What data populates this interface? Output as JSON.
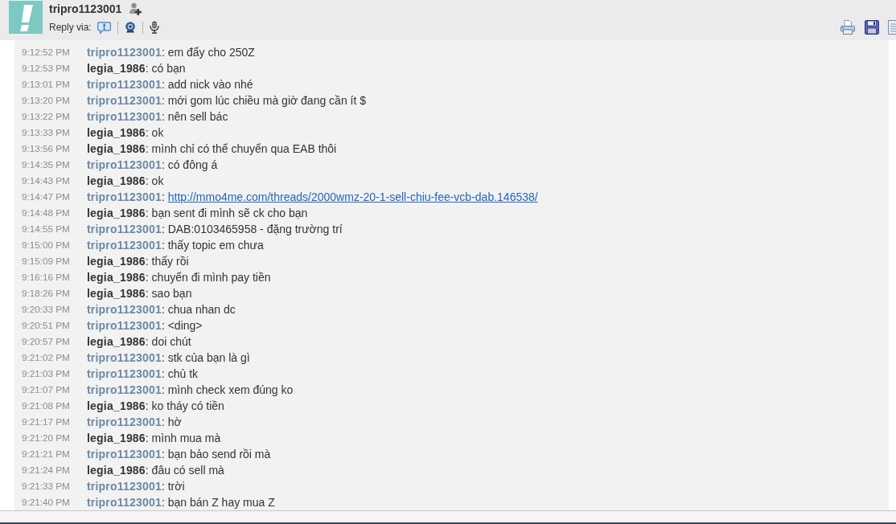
{
  "header": {
    "contact_name": "tripro1123001",
    "reply_via_label": "Reply via:"
  },
  "messages": [
    {
      "time": "9:12:52 PM",
      "sender": "tripro1123001",
      "kind": "contact",
      "text": ": em đẩy cho 250Z"
    },
    {
      "time": "9:12:53 PM",
      "sender": "legia_1986",
      "kind": "self",
      "text": ": có bạn"
    },
    {
      "time": "9:13:01 PM",
      "sender": "tripro1123001",
      "kind": "contact",
      "text": ": add nick vào nhé"
    },
    {
      "time": "9:13:20 PM",
      "sender": "tripro1123001",
      "kind": "contact",
      "text": ": mới gom lúc chiều mà giờ đang cần ít $"
    },
    {
      "time": "9:13:22 PM",
      "sender": "tripro1123001",
      "kind": "contact",
      "text": ": nên sell bác"
    },
    {
      "time": "9:13:33 PM",
      "sender": "legia_1986",
      "kind": "self",
      "text": ": ok"
    },
    {
      "time": "9:13:56 PM",
      "sender": "legia_1986",
      "kind": "self",
      "text": ": mình chỉ có thể chuyển qua EAB thôi"
    },
    {
      "time": "9:14:35 PM",
      "sender": "tripro1123001",
      "kind": "contact",
      "text": ": có đông á"
    },
    {
      "time": "9:14:43 PM",
      "sender": "legia_1986",
      "kind": "self",
      "text": ": ok"
    },
    {
      "time": "9:14:47 PM",
      "sender": "tripro1123001",
      "kind": "contact",
      "text": ":",
      "link": "http://mmo4me.com/threads/2000wmz-20-1-sell-chiu-fee-vcb-dab.146538/"
    },
    {
      "time": "9:14:48 PM",
      "sender": "legia_1986",
      "kind": "self",
      "text": ": bạn sent đi mình sẽ ck cho bạn"
    },
    {
      "time": "9:14:55 PM",
      "sender": "tripro1123001",
      "kind": "contact",
      "text": ": DAB:0103465958 - đặng trường trí"
    },
    {
      "time": "9:15:00 PM",
      "sender": "tripro1123001",
      "kind": "contact",
      "text": ": thấy topic em chưa"
    },
    {
      "time": "9:15:09 PM",
      "sender": "legia_1986",
      "kind": "self",
      "text": ": thấy rồi"
    },
    {
      "time": "9:16:16 PM",
      "sender": "legia_1986",
      "kind": "self",
      "text": ": chuyển đi mình pay tiền"
    },
    {
      "time": "9:18:26 PM",
      "sender": "legia_1986",
      "kind": "self",
      "text": ": sao bạn"
    },
    {
      "time": "9:20:33 PM",
      "sender": "tripro1123001",
      "kind": "contact",
      "text": ": chua nhan dc"
    },
    {
      "time": "9:20:51 PM",
      "sender": "tripro1123001",
      "kind": "contact",
      "text": ": <ding>"
    },
    {
      "time": "9:20:57 PM",
      "sender": "legia_1986",
      "kind": "self",
      "text": ": doi chút"
    },
    {
      "time": "9:21:02 PM",
      "sender": "tripro1123001",
      "kind": "contact",
      "text": ": stk của bạn là gì"
    },
    {
      "time": "9:21:03 PM",
      "sender": "tripro1123001",
      "kind": "contact",
      "text": ": chủ tk"
    },
    {
      "time": "9:21:07 PM",
      "sender": "tripro1123001",
      "kind": "contact",
      "text": ": mình check xem đúng ko"
    },
    {
      "time": "9:21:08 PM",
      "sender": "legia_1986",
      "kind": "self",
      "text": ": ko tháy có tiền"
    },
    {
      "time": "9:21:17 PM",
      "sender": "tripro1123001",
      "kind": "contact",
      "text": ": hờ"
    },
    {
      "time": "9:21:20 PM",
      "sender": "legia_1986",
      "kind": "self",
      "text": ": mình mua mà"
    },
    {
      "time": "9:21:21 PM",
      "sender": "tripro1123001",
      "kind": "contact",
      "text": ": bạn bảo send rồi mà"
    },
    {
      "time": "9:21:24 PM",
      "sender": "legia_1986",
      "kind": "self",
      "text": ": đâu có sell mà"
    },
    {
      "time": "9:21:33 PM",
      "sender": "tripro1123001",
      "kind": "contact",
      "text": ": trời"
    },
    {
      "time": "9:21:40 PM",
      "sender": "tripro1123001",
      "kind": "contact",
      "text": ": bạn bán Z hay mua Z"
    }
  ]
}
